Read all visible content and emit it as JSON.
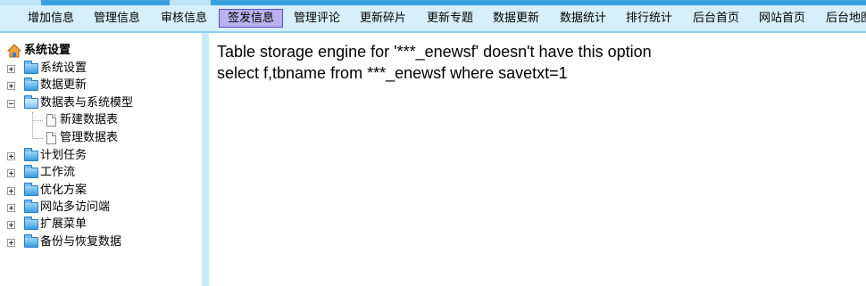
{
  "topnav": {
    "items": [
      {
        "label": "增加信息"
      },
      {
        "label": "管理信息"
      },
      {
        "label": "审核信息"
      },
      {
        "label": "签发信息",
        "active": true
      },
      {
        "label": "管理评论"
      },
      {
        "label": "更新碎片"
      },
      {
        "label": "更新专题"
      },
      {
        "label": "数据更新"
      },
      {
        "label": "数据统计"
      },
      {
        "label": "排行统计"
      },
      {
        "label": "后台首页"
      },
      {
        "label": "网站首页"
      },
      {
        "label": "后台地图"
      }
    ],
    "active_color": "#b9b2ee",
    "bar_color": "#d6effb"
  },
  "sidebar": {
    "title": "系统设置",
    "items": [
      {
        "label": "系统设置",
        "icon": "folder-icon",
        "expander": "plus"
      },
      {
        "label": "数据更新",
        "icon": "folder-icon",
        "expander": "plus"
      },
      {
        "label": "数据表与系统模型",
        "icon": "folder-open-icon",
        "expander": "minus",
        "children": [
          {
            "label": "新建数据表",
            "icon": "page-icon"
          },
          {
            "label": "管理数据表",
            "icon": "page-icon"
          }
        ]
      },
      {
        "label": "计划任务",
        "icon": "folder-icon",
        "expander": "plus"
      },
      {
        "label": "工作流",
        "icon": "folder-icon",
        "expander": "plus"
      },
      {
        "label": "优化方案",
        "icon": "folder-icon",
        "expander": "plus"
      },
      {
        "label": "网站多访问端",
        "icon": "folder-icon",
        "expander": "plus"
      },
      {
        "label": "扩展菜单",
        "icon": "folder-icon",
        "expander": "plus"
      },
      {
        "label": "备份与恢复数据",
        "icon": "folder-icon",
        "expander": "plus"
      }
    ]
  },
  "main": {
    "error_line": "Table storage engine for '***_enewsf' doesn't have this option",
    "sql_line": "select f,tbname from ***_enewsf where savetxt=1"
  }
}
